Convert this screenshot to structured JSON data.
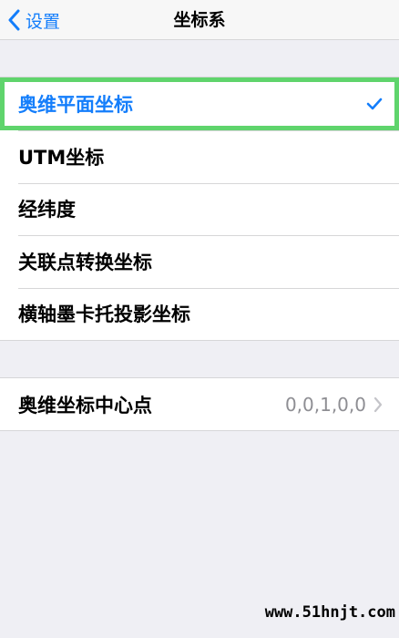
{
  "navbar": {
    "back_label": "设置",
    "title": "坐标系"
  },
  "coordinate_list": {
    "items": [
      {
        "label": "奥维平面坐标",
        "selected": true
      },
      {
        "label": "UTM坐标",
        "selected": false
      },
      {
        "label": "经纬度",
        "selected": false
      },
      {
        "label": "关联点转换坐标",
        "selected": false
      },
      {
        "label": "横轴墨卡托投影坐标",
        "selected": false
      }
    ]
  },
  "center_point": {
    "label": "奥维坐标中心点",
    "value": "0,0,1,0,0"
  },
  "watermark": "www.51hnjt.com",
  "colors": {
    "accent": "#147efb",
    "highlight_border": "#5fd46c",
    "secondary_text": "#8e8e93",
    "background": "#efeff4"
  },
  "icons": {
    "back": "chevron-left-icon",
    "selected": "check-icon",
    "disclosure": "chevron-right-icon"
  }
}
